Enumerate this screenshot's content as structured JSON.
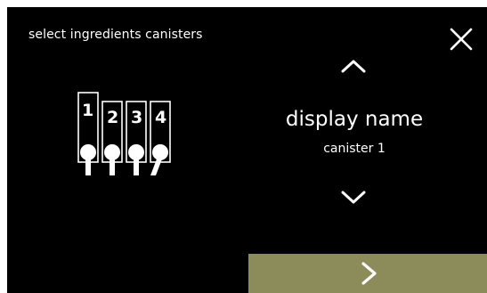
{
  "header": {
    "title": "select ingredients canisters",
    "close_icon": "close-icon"
  },
  "canisters": {
    "labels": [
      "1",
      "2",
      "3",
      "4"
    ],
    "selected_index": 0
  },
  "selector": {
    "up_icon": "chevron-up-icon",
    "display_name": "display name",
    "canister_name": "canister 1",
    "down_icon": "chevron-down-icon"
  },
  "footer": {
    "next_icon": "chevron-right-icon"
  },
  "colors": {
    "background": "#000000",
    "foreground": "#ffffff",
    "next_button": "#8c8c5a"
  }
}
